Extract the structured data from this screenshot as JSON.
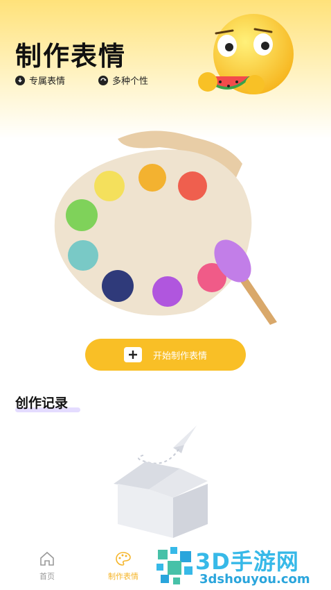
{
  "header": {
    "title": "制作表情",
    "features": [
      {
        "label": "专属表情",
        "icon": "cloud-download-icon"
      },
      {
        "label": "多种个性",
        "icon": "refresh-icon"
      }
    ]
  },
  "start_button": {
    "label": "开始制作表情",
    "icon": "plus-icon"
  },
  "records": {
    "title": "创作记录",
    "empty_icon": "empty-box-icon"
  },
  "tabbar": {
    "tabs": [
      {
        "label": "首页",
        "icon": "home-icon",
        "active": false
      },
      {
        "label": "制作表情",
        "icon": "palette-icon",
        "active": true
      }
    ]
  },
  "watermark": {
    "title": "3D手游网",
    "subtitle": "3dshouyou.com"
  },
  "colors": {
    "accent": "#f9bf26",
    "tab_active": "#f5b52a",
    "tab_inactive": "#999999"
  }
}
